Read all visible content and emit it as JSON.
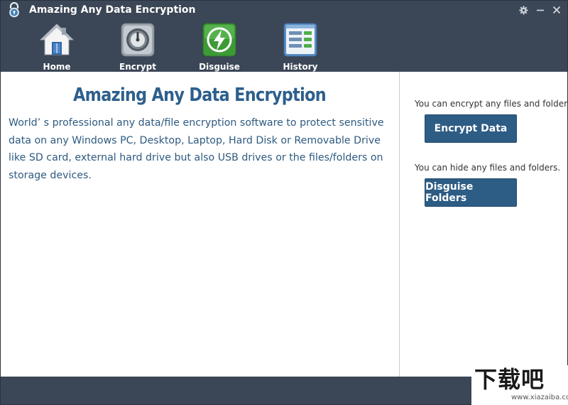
{
  "app": {
    "title": "Amazing Any Data Encryption",
    "logo_icon": "padlock-icon"
  },
  "window_controls": {
    "settings_icon": "gear-icon",
    "minimize_icon": "minimize-icon",
    "close_icon": "close-icon"
  },
  "nav": {
    "items": [
      {
        "label": "Home",
        "icon": "home-icon"
      },
      {
        "label": "Encrypt",
        "icon": "safe-dial-icon"
      },
      {
        "label": "Disguise",
        "icon": "shield-lightning-icon"
      },
      {
        "label": "History",
        "icon": "history-list-icon"
      }
    ]
  },
  "main": {
    "title": "Amazing Any Data Encryption",
    "description": "World’ s professional any data/file encryption software to protect sensitive data on any Windows PC, Desktop, Laptop, Hard Disk or Removable Drive like SD card, external hard drive but also USB drives or the files/folders on storage devices."
  },
  "sidebar": {
    "encrypt_hint": "You can encrypt any files and folders.",
    "encrypt_button": "Encrypt Data",
    "disguise_hint": "You can hide any files and folders.",
    "disguise_button": "Disguise Folders"
  },
  "watermark": {
    "logo_text": "下载吧",
    "url": "www.xiazaiba.com"
  },
  "colors": {
    "header_bg": "#3b4656",
    "accent_blue": "#2d5c85",
    "title_blue": "#2d5f8c",
    "text_blue": "#2e5a80"
  }
}
